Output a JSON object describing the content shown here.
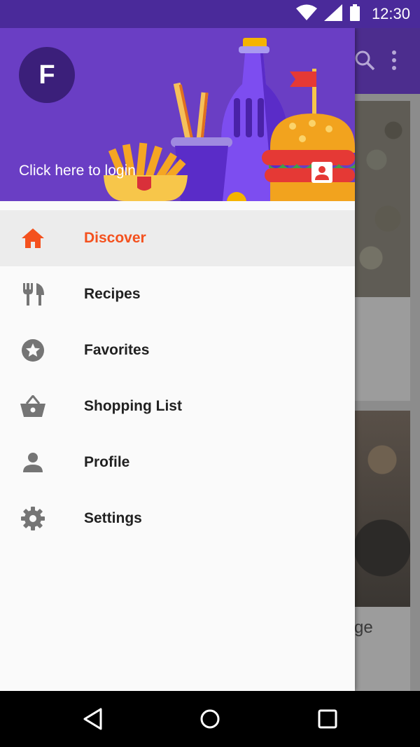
{
  "status_bar": {
    "time": "12:30"
  },
  "header": {
    "avatar_letter": "F",
    "login_text": "Click here to login"
  },
  "menu": [
    {
      "label": "Discover",
      "icon": "home-icon",
      "active": true
    },
    {
      "label": "Recipes",
      "icon": "fork-knife-icon"
    },
    {
      "label": "Favorites",
      "icon": "star-icon"
    },
    {
      "label": "Shopping List",
      "icon": "basket-icon"
    },
    {
      "label": "Profile",
      "icon": "person-icon"
    },
    {
      "label": "Settings",
      "icon": "gear-icon"
    }
  ],
  "background": {
    "card2_text_fragment": "ge"
  },
  "colors": {
    "primary": "#6a3ec4",
    "status_bar": "#4a2a9a",
    "accent": "#f4511e",
    "icon_gray": "#757575"
  }
}
